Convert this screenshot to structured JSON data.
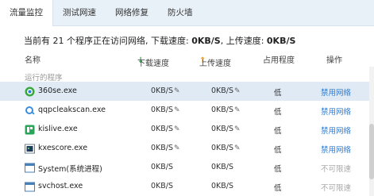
{
  "tabs": [
    {
      "label": "流量监控"
    },
    {
      "label": "测试网速"
    },
    {
      "label": "网络修复"
    },
    {
      "label": "防火墙"
    }
  ],
  "summary": {
    "prefix": "当前有 21 个程序正在访问网络, 下载速度: ",
    "download": "0KB/S",
    "middle": ", 上传速度: ",
    "upload": "0KB/S"
  },
  "columns": {
    "name": "名称",
    "download": "下载速度",
    "upload": "上传速度",
    "level": "占用程度",
    "action": "操作"
  },
  "group_label": "运行的程序",
  "rows": [
    {
      "name": "360se.exe",
      "download": "0KB/S",
      "upload": "0KB/S",
      "level": "低",
      "action": "禁用网络",
      "icon": "360se-icon"
    },
    {
      "name": "qqpcleakscan.exe",
      "download": "0KB/S",
      "upload": "0KB/S",
      "level": "低",
      "action": "禁用网络",
      "icon": "qq-pc-icon"
    },
    {
      "name": "kislive.exe",
      "download": "0KB/S",
      "upload": "0KB/S",
      "level": "低",
      "action": "禁用网络",
      "icon": "kislive-icon"
    },
    {
      "name": "kxescore.exe",
      "download": "0KB/S",
      "upload": "0KB/S",
      "level": "低",
      "action": "禁用网络",
      "icon": "kxescore-icon"
    },
    {
      "name": "System(系统进程)",
      "download": "0KB/S",
      "upload": "0KB/S",
      "level": "低",
      "action": "不可限速",
      "icon": "window-icon"
    },
    {
      "name": "svchost.exe",
      "download": "0KB/S",
      "upload": "0KB/S",
      "level": "低",
      "action": "不可限速",
      "icon": "window-icon"
    }
  ],
  "colors": {
    "accent": "#2e7bd1",
    "selected_row": "#dfeaf5",
    "download_arrow": "#2fa84a",
    "upload_arrow": "#f0a020"
  }
}
